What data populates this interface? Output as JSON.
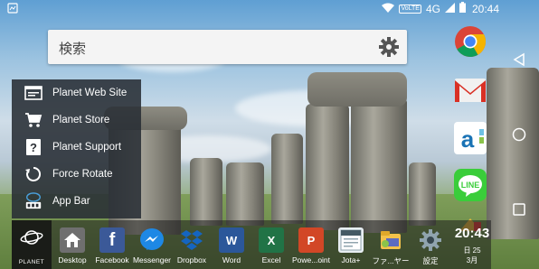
{
  "status": {
    "volte": "VoLTE",
    "network": "4G",
    "time": "20:44"
  },
  "search": {
    "placeholder": "検索"
  },
  "popup_menu": [
    {
      "label": "Planet Web Site",
      "icon": "browser-window-icon"
    },
    {
      "label": "Planet Store",
      "icon": "cart-icon"
    },
    {
      "label": "Planet Support",
      "icon": "help-icon"
    },
    {
      "label": "Force Rotate",
      "icon": "rotate-icon"
    },
    {
      "label": "App Bar",
      "icon": "app-bar-icon"
    }
  ],
  "planet_button": {
    "label": "PLANET"
  },
  "dock_apps": [
    {
      "label": "Desktop",
      "icon": "home-icon",
      "color": "#6f6f6f"
    },
    {
      "label": "Facebook",
      "icon": "facebook-icon",
      "color": "#3b5998"
    },
    {
      "label": "Messenger",
      "icon": "messenger-icon",
      "color": "#1e88e5"
    },
    {
      "label": "Dropbox",
      "icon": "dropbox-icon",
      "color": "#1565c0"
    },
    {
      "label": "Word",
      "icon": "word-icon",
      "color": "#2b579a"
    },
    {
      "label": "Excel",
      "icon": "excel-icon",
      "color": "#217346"
    },
    {
      "label": "Powe...oint",
      "icon": "powerpoint-icon",
      "color": "#d24726"
    },
    {
      "label": "Jota+",
      "icon": "jota-icon",
      "color": "#e8eef2"
    },
    {
      "label": "ファ...ヤー",
      "icon": "file-manager-icon",
      "color": "#5c6bc0"
    },
    {
      "label": "設定",
      "icon": "settings-icon",
      "color": "#607d8b"
    }
  ],
  "clock_widget": {
    "time": "20:43",
    "day": "日 25",
    "month": "3月"
  },
  "right_dock": [
    {
      "icon": "chrome-icon"
    },
    {
      "icon": "gmail-icon"
    },
    {
      "icon": "amazon-icon"
    },
    {
      "icon": "line-icon",
      "label": "LINE"
    },
    {
      "icon": "app-icon"
    }
  ]
}
